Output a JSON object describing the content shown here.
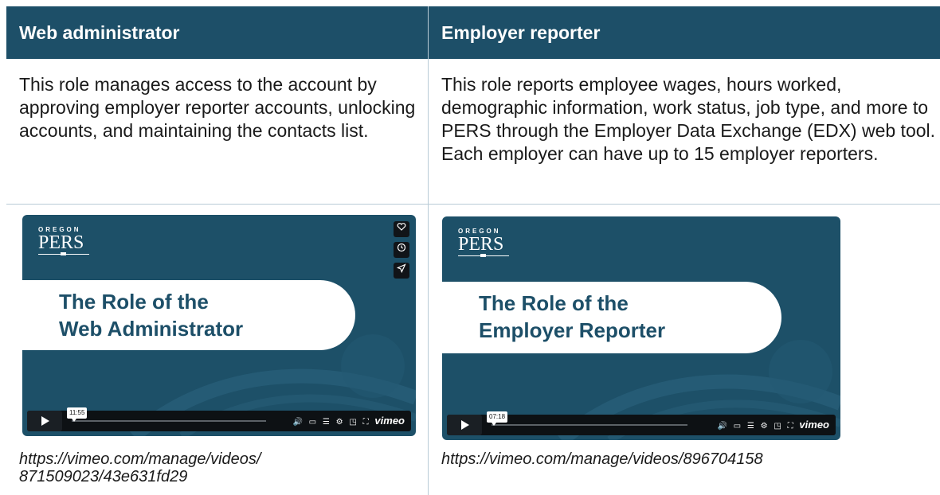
{
  "headers": {
    "col1": "Web administrator",
    "col2": "Employer reporter"
  },
  "descriptions": {
    "col1": "This role manages access to the account by approving employer reporter accounts, unlocking accounts, and maintaining the contacts list.",
    "col2": "This role reports employee wages, hours worked, demographic information, work status, job type, and more to PERS through the Employer Data Exchange (EDX) web tool. Each employer can have up to 15 employer reporters."
  },
  "videos": [
    {
      "brand_top": "OREGON",
      "brand_main": "PERS",
      "title_line1": "The Role of the",
      "title_line2": "Web Administrator",
      "time": "11:55",
      "player_brand": "vimeo",
      "link_line1": "https://vimeo.com/manage/videos/",
      "link_line2": "871509023/43e631fd29"
    },
    {
      "brand_top": "OREGON",
      "brand_main": "PERS",
      "title_line1": "The Role of the",
      "title_line2": "Employer Reporter",
      "time": "07:18",
      "player_brand": "vimeo",
      "link_line1": "https://vimeo.com/manage/videos/896704158"
    }
  ],
  "icons": {
    "side": [
      "heart-icon",
      "clock-icon",
      "share-icon"
    ],
    "controls": [
      "play-icon",
      "volume-icon",
      "cc-icon",
      "transcript-icon",
      "settings-icon",
      "pip-icon",
      "fullscreen-icon"
    ]
  },
  "colors": {
    "header_bg": "#1d4f68",
    "video_bg": "#1d5068",
    "grid_line": "#b8cbd6"
  }
}
